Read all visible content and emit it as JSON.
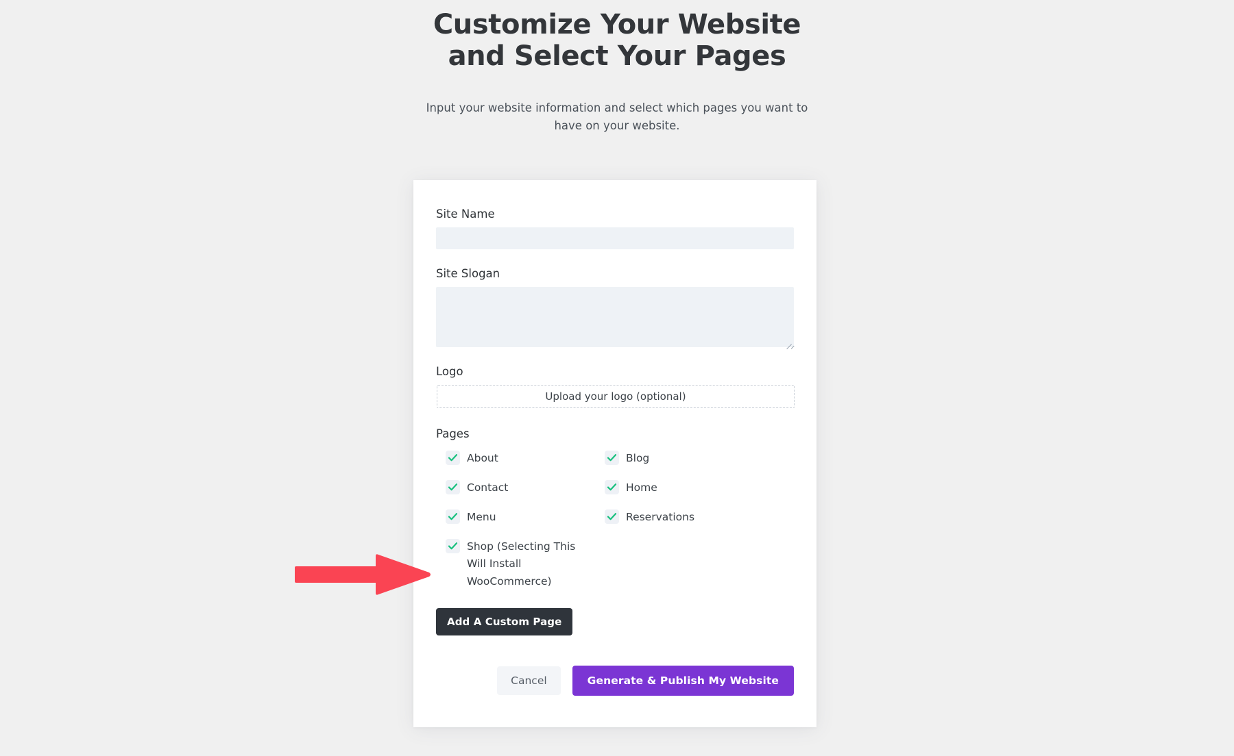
{
  "header": {
    "title": "Customize Your Website and Select Your Pages",
    "subtitle": "Input your website information and select which pages you want to have on your website."
  },
  "form": {
    "site_name": {
      "label": "Site Name",
      "value": "",
      "placeholder": ""
    },
    "site_slogan": {
      "label": "Site Slogan",
      "value": "",
      "placeholder": ""
    },
    "logo": {
      "label": "Logo",
      "dropzone_text": "Upload your logo (optional)"
    },
    "pages": {
      "label": "Pages",
      "items": [
        {
          "label": "About",
          "checked": true
        },
        {
          "label": "Blog",
          "checked": true
        },
        {
          "label": "Contact",
          "checked": true
        },
        {
          "label": "Home",
          "checked": true
        },
        {
          "label": "Menu",
          "checked": true
        },
        {
          "label": "Reservations",
          "checked": true
        },
        {
          "label": "Shop (Selecting This Will Install WooCommerce)",
          "checked": true
        }
      ]
    },
    "add_custom_page_label": "Add A Custom Page"
  },
  "actions": {
    "cancel_label": "Cancel",
    "submit_label": "Generate & Publish My Website"
  },
  "annotation": {
    "type": "arrow-right",
    "points_at": "Shop (Selecting This Will Install WooCommerce)",
    "color": "#fa4453"
  },
  "colors": {
    "page_background": "#f0f0f0",
    "card_background": "#ffffff",
    "input_fill": "#eef2f6",
    "checkbox_fill": "#eef1f6",
    "check_green": "#17c07e",
    "primary_purple": "#7b35d4",
    "dark_button": "#2f343b",
    "cancel_button": "#f3f5f8",
    "annotation_red": "#fa4453",
    "heading_text": "#33363a",
    "body_text": "#3c4248"
  }
}
